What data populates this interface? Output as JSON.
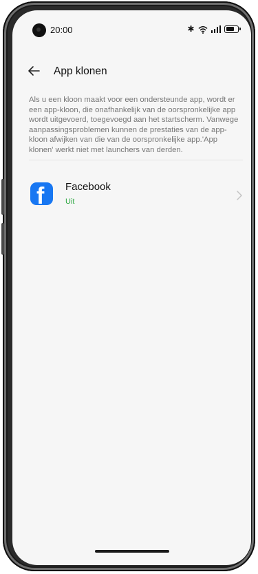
{
  "status_bar": {
    "time": "20:00",
    "icons": [
      "bluetooth-icon",
      "wifi-icon",
      "signal-icon",
      "battery-icon"
    ]
  },
  "header": {
    "back_icon": "arrow-left-icon",
    "title": "App klonen"
  },
  "description": "Als u een kloon maakt voor een ondersteunde app, wordt er een app-kloon, die onafhankelijk van de oorspronkelijke app wordt uitgevoerd, toegevoegd aan het startscherm. Vanwege aanpassingsproblemen kunnen de prestaties van de app-kloon afwijken van die van de oorspronkelijke app.'App klonen' werkt niet met launchers van derden.",
  "apps": [
    {
      "name": "Facebook",
      "status": "Uit",
      "icon": "facebook-icon",
      "icon_letter": "f"
    }
  ],
  "colors": {
    "status_off": "#2aa63f",
    "facebook_blue": "#1877f2",
    "screen_bg": "#f6f6f6"
  }
}
